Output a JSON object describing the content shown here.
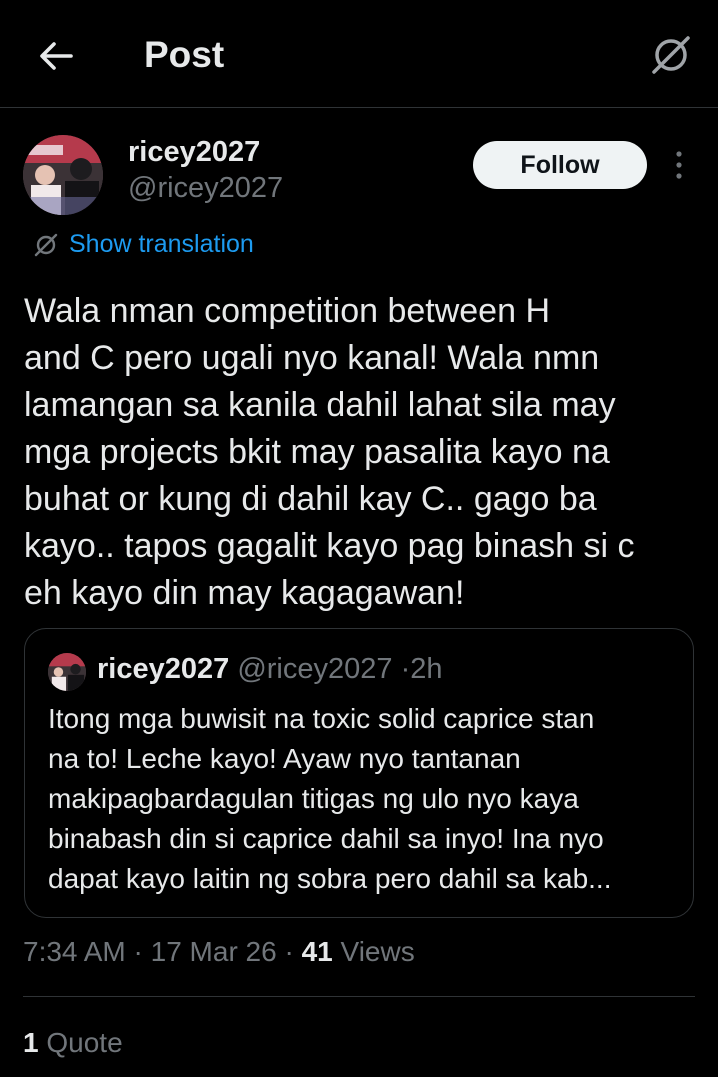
{
  "header": {
    "title": "Post",
    "back_icon": "arrow-left-icon",
    "grok_icon": "grok-icon"
  },
  "author": {
    "name": "ricey2027",
    "handle": "@ricey2027",
    "follow_label": "Follow",
    "more_icon": "more-vertical-icon"
  },
  "translate": {
    "label": "Show translation",
    "icon": "grok-icon"
  },
  "post": {
    "text": "Wala nman competition between H\nand C pero ugali nyo kanal! Wala nmn\nlamangan sa kanila dahil lahat sila may\nmga projects bkit may pasalita kayo na\nbuhat or kung di dahil kay C.. gago ba\nkayo.. tapos gagalit kayo pag binash si c\neh kayo din may kagagawan!",
    "time": "7:34 AM",
    "date": "17 Mar 26",
    "views_count": "41",
    "views_label": "Views"
  },
  "quoted_post": {
    "name": "ricey2027",
    "handle": "@ricey2027",
    "age": "2h",
    "text": "Itong mga buwisit na toxic solid caprice stan\nna to! Leche kayo! Ayaw nyo tantanan\nmakipagbardagulan titigas ng ulo nyo kaya\nbinabash din si caprice dahil sa inyo! Ina nyo\ndapat kayo laitin ng sobra pero dahil sa kab..."
  },
  "stats": {
    "quote_count": "1",
    "quote_label": "Quote"
  },
  "colors": {
    "background": "#000000",
    "text": "#e7e9ea",
    "muted": "#71767b",
    "link": "#1d9bf0",
    "border": "#2f3336"
  }
}
